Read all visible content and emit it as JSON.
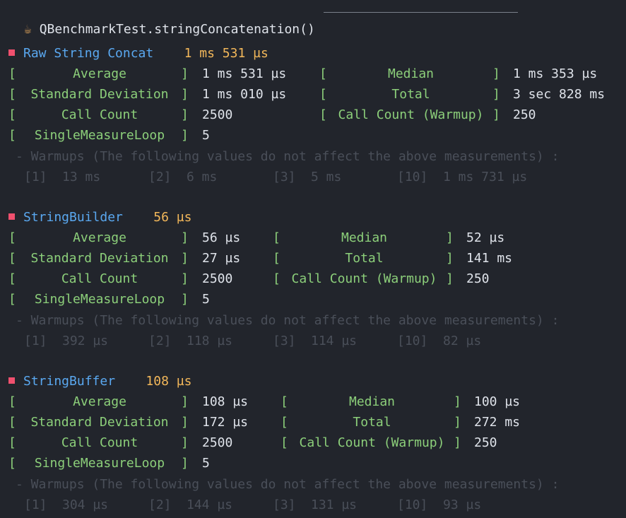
{
  "title": {
    "icon": "coffee-cup-icon",
    "text": "QBenchmarkTest.stringConcatenation()"
  },
  "labels": {
    "average": "Average",
    "median": "Median",
    "std_dev": "Standard Deviation",
    "total": "Total",
    "call_count": "Call Count",
    "call_count_warmup": "Call Count (Warmup)",
    "single_measure_loop": "SingleMeasureLoop",
    "warmups_note": "- Warmups (The following values do not affect the above measurements) :"
  },
  "benchmarks": [
    {
      "name": "Raw String Concat",
      "score": "1 ms 531 µs",
      "average": "1 ms 531 µs",
      "median": "1 ms 353 µs",
      "std_dev": "1 ms 010 µs",
      "total": "3 sec 828 ms",
      "call_count": "2500",
      "call_count_warmup": "250",
      "single_measure_loop": "5",
      "warmups": [
        {
          "index": "[1]",
          "value": "13 ms"
        },
        {
          "index": "[2]",
          "value": "6 ms"
        },
        {
          "index": "[3]",
          "value": "5 ms"
        },
        {
          "index": "[10]",
          "value": "1 ms 731 µs"
        }
      ]
    },
    {
      "name": "StringBuilder",
      "score": "56 µs",
      "average": "56 µs",
      "median": "52 µs",
      "std_dev": "27 µs",
      "total": "141 ms",
      "call_count": "2500",
      "call_count_warmup": "250",
      "single_measure_loop": "5",
      "warmups": [
        {
          "index": "[1]",
          "value": "392 µs"
        },
        {
          "index": "[2]",
          "value": "118 µs"
        },
        {
          "index": "[3]",
          "value": "114 µs"
        },
        {
          "index": "[10]",
          "value": "82 µs"
        }
      ]
    },
    {
      "name": "StringBuffer",
      "score": "108 µs",
      "average": "108 µs",
      "median": "100 µs",
      "std_dev": "172 µs",
      "total": "272 ms",
      "call_count": "2500",
      "call_count_warmup": "250",
      "single_measure_loop": "5",
      "warmups": [
        {
          "index": "[1]",
          "value": "304 µs"
        },
        {
          "index": "[2]",
          "value": "144 µs"
        },
        {
          "index": "[3]",
          "value": "131 µs"
        },
        {
          "index": "[10]",
          "value": "93 µs"
        }
      ]
    }
  ],
  "colors": {
    "background": "#22252c",
    "benchmark_name": "#5aa8f0",
    "score": "#f2b75a",
    "label": "#8ccf7a",
    "value": "#dfe3ea",
    "muted": "#4a4f59",
    "marker": "#f0506e"
  }
}
